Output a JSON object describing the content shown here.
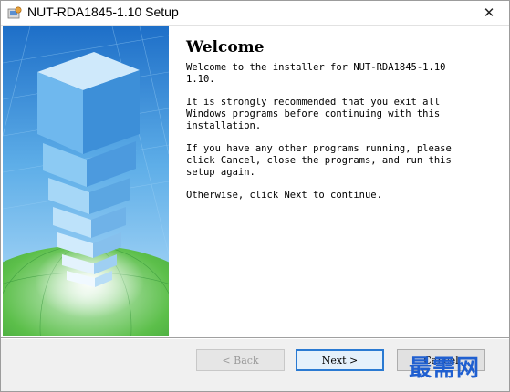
{
  "window": {
    "title": "NUT-RDA1845-1.10 Setup",
    "close_symbol": "✕"
  },
  "welcome": {
    "heading": "Welcome",
    "paragraphs": [
      "Welcome to the installer for NUT-RDA1845-1.10\n1.10.",
      "It is strongly recommended that you exit all\nWindows programs before continuing with this\ninstallation.",
      "If you have any other programs running, please\nclick Cancel, close the programs, and run this\nsetup again.",
      "Otherwise, click Next to continue."
    ]
  },
  "buttons": {
    "back": "< Back",
    "next": "Next >",
    "cancel": "Cancel"
  },
  "watermark": "最需网",
  "colors": {
    "sky": "#4a9ee0",
    "globe": "#3ca43c",
    "accent": "#2a7ad2"
  },
  "icons": {
    "app": "installer-icon",
    "close": "close-icon"
  }
}
